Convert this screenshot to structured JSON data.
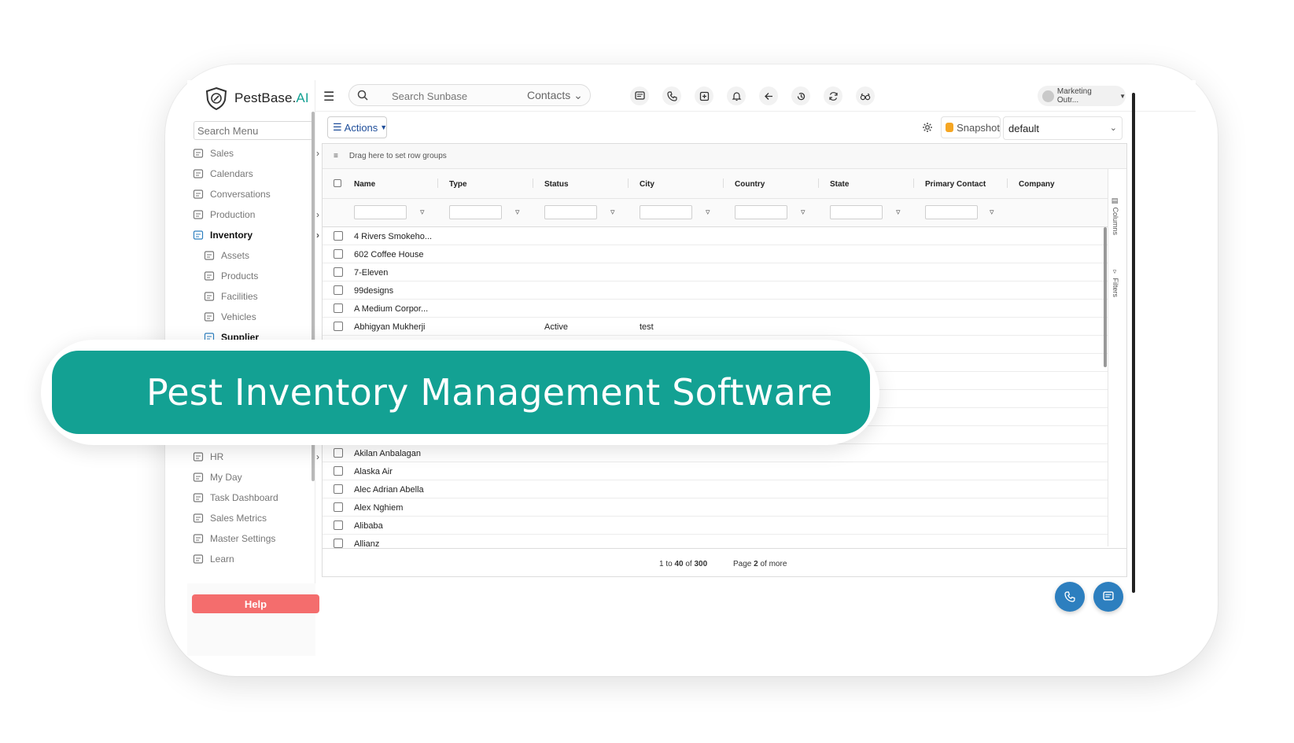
{
  "app": {
    "brand_part1": "PestBase.",
    "brand_part2": "AI",
    "accent_color": "#13a193"
  },
  "sidebar": {
    "search_placeholder": "Search Menu",
    "items": [
      {
        "label": "Sales",
        "icon": "chart-icon",
        "chevron": true
      },
      {
        "label": "Calendars",
        "icon": "calendar-icon",
        "chevron": false
      },
      {
        "label": "Conversations",
        "icon": "chat-icon",
        "chevron": false
      },
      {
        "label": "Production",
        "icon": "factory-icon",
        "chevron": true
      },
      {
        "label": "Inventory",
        "icon": "box-icon",
        "chevron": true,
        "active": true
      },
      {
        "label": "Assets",
        "icon": "asset-icon",
        "sub": true
      },
      {
        "label": "Products",
        "icon": "product-icon",
        "sub": true
      },
      {
        "label": "Facilities",
        "icon": "building-icon",
        "sub": true
      },
      {
        "label": "Vehicles",
        "icon": "truck-icon",
        "sub": true
      },
      {
        "label": "Supplier",
        "icon": "supplier-icon",
        "sub": true,
        "active": true
      }
    ],
    "items_bottom": [
      {
        "label": "HR",
        "icon": "person-icon",
        "chevron": true
      },
      {
        "label": "My Day",
        "icon": "myday-icon"
      },
      {
        "label": "Task Dashboard",
        "icon": "dashboard-icon"
      },
      {
        "label": "Sales Metrics",
        "icon": "metrics-icon"
      },
      {
        "label": "Master Settings",
        "icon": "settings-icon"
      },
      {
        "label": "Learn",
        "icon": "books-icon"
      }
    ],
    "help_label": "Help"
  },
  "topbar": {
    "search_placeholder": "Search Sunbase",
    "search_context": "Contacts",
    "user_name": "Marketing Outr..."
  },
  "toolbar": {
    "actions_label": "Actions",
    "snapshot_label": "Snapshot",
    "view_selected": "default"
  },
  "grid": {
    "row_group_hint": "Drag here to set row groups",
    "columns": [
      "Name",
      "Type",
      "Status",
      "City",
      "Country",
      "State",
      "Primary Contact",
      "Company"
    ],
    "side_tabs": [
      "Columns",
      "Filters"
    ],
    "rows_top": [
      {
        "name": "4 Rivers Smokeho...",
        "status": "",
        "city": ""
      },
      {
        "name": "602 Coffee House",
        "status": "",
        "city": ""
      },
      {
        "name": "7-Eleven",
        "status": "",
        "city": ""
      },
      {
        "name": "99designs",
        "status": "",
        "city": ""
      },
      {
        "name": "A Medium Corpor...",
        "status": "",
        "city": ""
      },
      {
        "name": "Abhigyan Mukherji",
        "status": "Active",
        "city": "test"
      }
    ],
    "rows_bottom": [
      {
        "name": "Akilan Anbalagan"
      },
      {
        "name": "Alaska Air"
      },
      {
        "name": "Alec Adrian Abella"
      },
      {
        "name": "Alex Nghiem"
      },
      {
        "name": "Alibaba"
      },
      {
        "name": "Allianz"
      }
    ],
    "footer": {
      "range_prefix": "1 to ",
      "range_end": "40",
      "range_of": " of ",
      "range_total": "300",
      "page_prefix": "Page ",
      "page_num": "2",
      "page_suffix": " of more"
    }
  },
  "banner": {
    "text": "Pest Inventory Management Software"
  }
}
